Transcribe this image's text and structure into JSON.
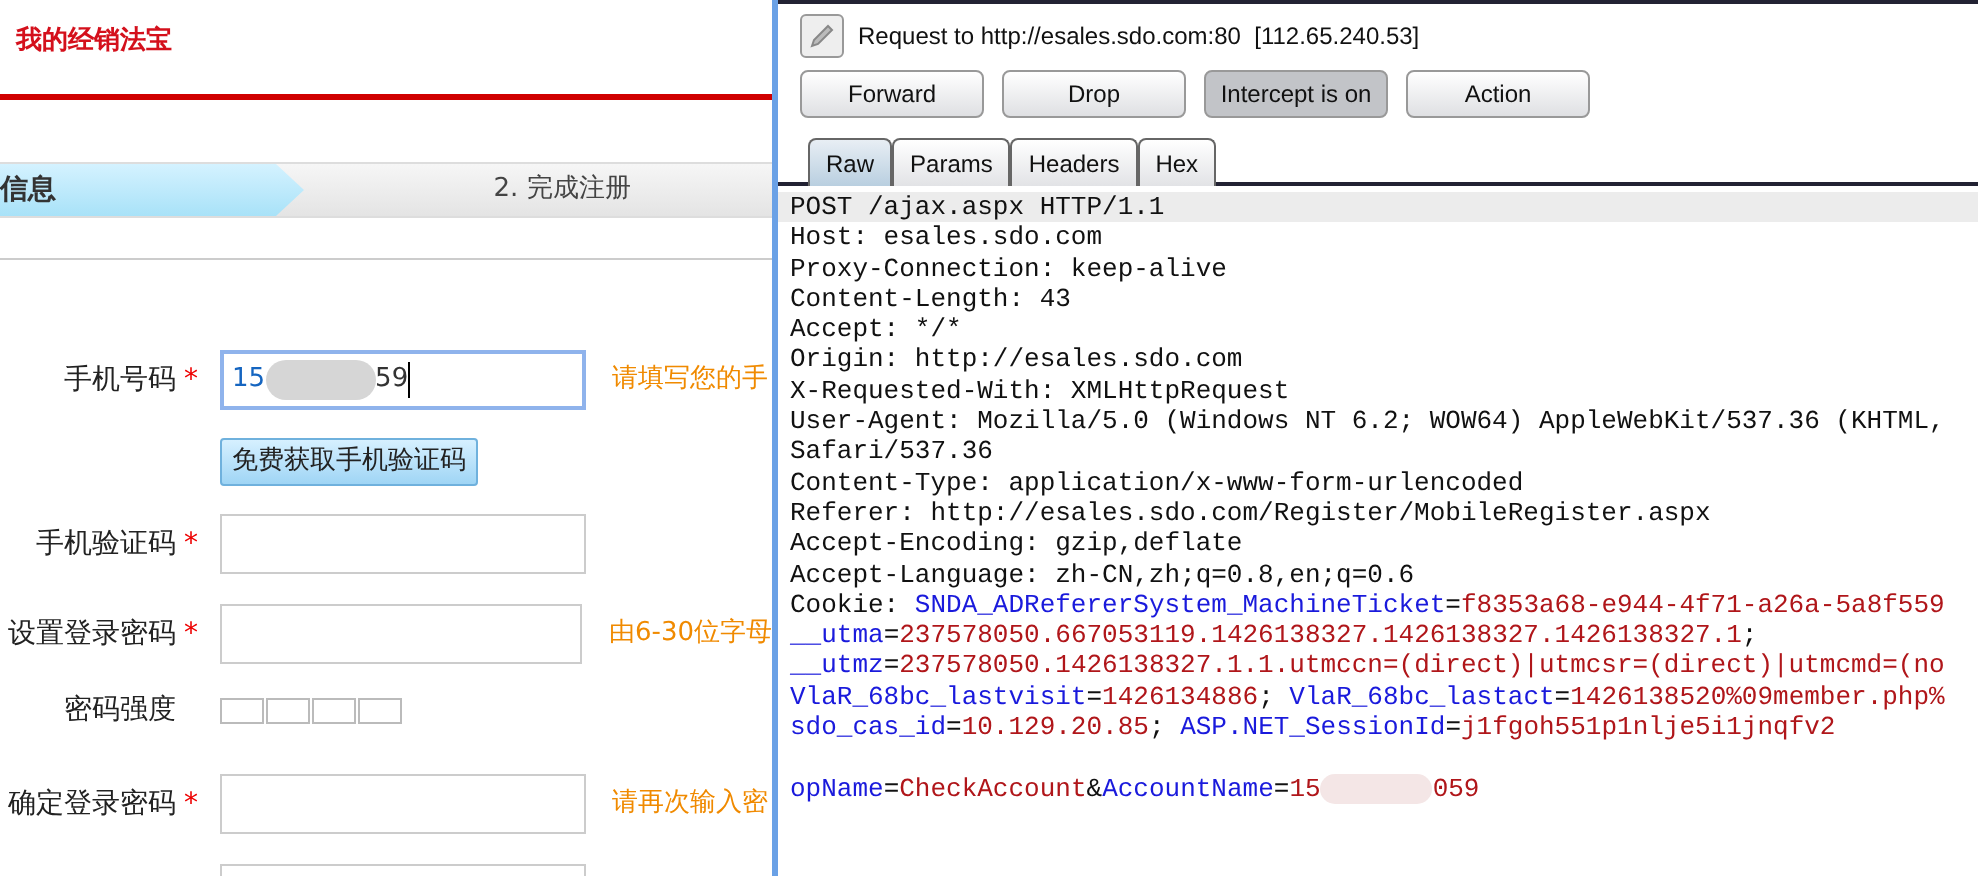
{
  "site": {
    "title": "我的经销法宝",
    "steps": [
      {
        "label": "信息",
        "selected": true
      },
      {
        "label": "2. 完成注册",
        "selected": false
      }
    ]
  },
  "form": {
    "rows": [
      {
        "kind": "input",
        "label": "手机号码",
        "required_mark": "*",
        "value_start": "15",
        "value_end": "59",
        "redacted": true,
        "hint": "请填写您的手"
      },
      {
        "kind": "button",
        "label": "免费获取手机验证码"
      },
      {
        "kind": "input",
        "label": "手机验证码",
        "required_mark": "*"
      },
      {
        "kind": "input",
        "label": "设置登录密码",
        "required_mark": "*",
        "hint": "由6-30位字母"
      },
      {
        "kind": "strength",
        "label": "密码强度"
      },
      {
        "kind": "input",
        "label": "确定登录密码",
        "required_mark": "*",
        "hint": "请再次输入密"
      },
      {
        "kind": "input"
      }
    ]
  },
  "proxy": {
    "request_label": "Request to http://esales.sdo.com:80  [112.65.240.53]",
    "buttons": [
      {
        "label": "Forward",
        "pressed": false
      },
      {
        "label": "Drop",
        "pressed": false
      },
      {
        "label": "Intercept is on",
        "pressed": true
      },
      {
        "label": "Action",
        "pressed": false
      }
    ],
    "tabs": [
      {
        "label": "Raw",
        "selected": true
      },
      {
        "label": "Params",
        "selected": false
      },
      {
        "label": "Headers",
        "selected": false
      },
      {
        "label": "Hex",
        "selected": false
      }
    ],
    "lines": [
      {
        "current": true,
        "segments": [
          {
            "kind": "plain",
            "text": "POST /ajax.aspx HTTP/1.1"
          }
        ]
      },
      {
        "current": false,
        "segments": [
          {
            "kind": "plain",
            "text": "Host: esales.sdo.com"
          }
        ]
      },
      {
        "current": false,
        "segments": [
          {
            "kind": "plain",
            "text": "Proxy-Connection: keep-alive"
          }
        ]
      },
      {
        "current": false,
        "segments": [
          {
            "kind": "plain",
            "text": "Content-Length: 43"
          }
        ]
      },
      {
        "current": false,
        "segments": [
          {
            "kind": "plain",
            "text": "Accept: */*"
          }
        ]
      },
      {
        "current": false,
        "segments": [
          {
            "kind": "plain",
            "text": "Origin: http://esales.sdo.com"
          }
        ]
      },
      {
        "current": false,
        "segments": [
          {
            "kind": "plain",
            "text": "X-Requested-With: XMLHttpRequest"
          }
        ]
      },
      {
        "current": false,
        "segments": [
          {
            "kind": "plain",
            "text": "User-Agent: Mozilla/5.0 (Windows NT 6.2; WOW64) AppleWebKit/537.36 (KHTML,"
          }
        ]
      },
      {
        "current": false,
        "segments": [
          {
            "kind": "plain",
            "text": "Safari/537.36"
          }
        ]
      },
      {
        "current": false,
        "segments": [
          {
            "kind": "plain",
            "text": "Content-Type: application/x-www-form-urlencoded"
          }
        ]
      },
      {
        "current": false,
        "segments": [
          {
            "kind": "plain",
            "text": "Referer: http://esales.sdo.com/Register/MobileRegister.aspx"
          }
        ]
      },
      {
        "current": false,
        "segments": [
          {
            "kind": "plain",
            "text": "Accept-Encoding: gzip,deflate"
          }
        ]
      },
      {
        "current": false,
        "segments": [
          {
            "kind": "plain",
            "text": "Accept-Language: zh-CN,zh;q=0.8,en;q=0.6"
          }
        ]
      },
      {
        "current": false,
        "segments": [
          {
            "kind": "plain",
            "text": "Cookie: "
          },
          {
            "kind": "key",
            "text": "SNDA_ADRefererSystem_MachineTicket"
          },
          {
            "kind": "plain",
            "text": "="
          },
          {
            "kind": "value",
            "text": "f8353a68-e944-4f71-a26a-5a8f559"
          }
        ]
      },
      {
        "current": false,
        "segments": [
          {
            "kind": "key",
            "text": "__utma"
          },
          {
            "kind": "plain",
            "text": "="
          },
          {
            "kind": "value",
            "text": "237578050.667053119.1426138327.1426138327.1426138327.1"
          },
          {
            "kind": "plain",
            "text": ";"
          }
        ]
      },
      {
        "current": false,
        "segments": [
          {
            "kind": "key",
            "text": "__utmz"
          },
          {
            "kind": "plain",
            "text": "="
          },
          {
            "kind": "value",
            "text": "237578050.1426138327.1.1.utmccn=(direct)|utmcsr=(direct)|utmcmd=(no"
          }
        ]
      },
      {
        "current": false,
        "segments": [
          {
            "kind": "key",
            "text": "VlaR_68bc_lastvisit"
          },
          {
            "kind": "plain",
            "text": "="
          },
          {
            "kind": "value",
            "text": "1426134886"
          },
          {
            "kind": "plain",
            "text": "; "
          },
          {
            "kind": "key",
            "text": "VlaR_68bc_lastact"
          },
          {
            "kind": "plain",
            "text": "="
          },
          {
            "kind": "value",
            "text": "1426138520%09member.php%"
          }
        ]
      },
      {
        "current": false,
        "segments": [
          {
            "kind": "key",
            "text": "sdo_cas_id"
          },
          {
            "kind": "plain",
            "text": "="
          },
          {
            "kind": "value",
            "text": "10.129.20.85"
          },
          {
            "kind": "plain",
            "text": "; "
          },
          {
            "kind": "key",
            "text": "ASP.NET_SessionId"
          },
          {
            "kind": "plain",
            "text": "="
          },
          {
            "kind": "value",
            "text": "j1fgoh551p1nlje5i1jnqfv2"
          }
        ]
      },
      {
        "current": false,
        "blank_before": true,
        "segments": [
          {
            "kind": "key",
            "text": "opName"
          },
          {
            "kind": "plain",
            "text": "="
          },
          {
            "kind": "value",
            "text": "CheckAccount"
          },
          {
            "kind": "plain",
            "text": "&"
          },
          {
            "kind": "key",
            "text": "AccountName"
          },
          {
            "kind": "plain",
            "text": "="
          },
          {
            "kind": "value",
            "text": "15"
          },
          {
            "kind": "redacted"
          },
          {
            "kind": "value",
            "text": "059"
          }
        ]
      }
    ]
  }
}
